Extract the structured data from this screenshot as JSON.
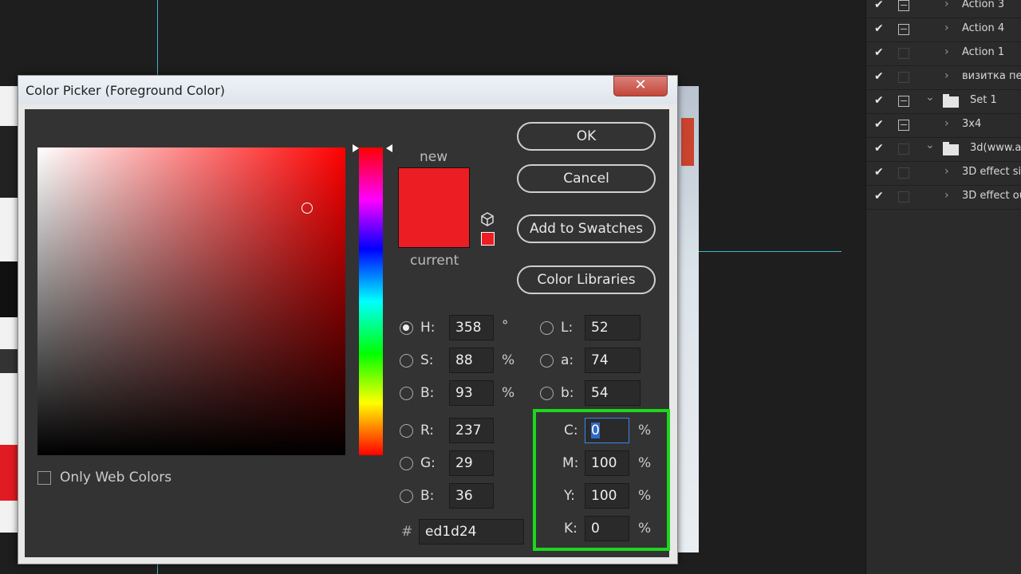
{
  "dialog": {
    "title": "Color Picker (Foreground Color)",
    "close_glyph": "✕",
    "new_label": "new",
    "current_label": "current",
    "new_color": "#ed1d24",
    "current_color": "#ed1d24",
    "buttons": {
      "ok": "OK",
      "cancel": "Cancel",
      "add_swatches": "Add to Swatches",
      "color_libraries": "Color Libraries"
    },
    "only_web_colors": "Only Web Colors",
    "hsb": {
      "h_label": "H:",
      "h_value": "358",
      "h_unit": "°",
      "s_label": "S:",
      "s_value": "88",
      "s_unit": "%",
      "b_label": "B:",
      "b_value": "93",
      "b_unit": "%"
    },
    "rgb": {
      "r_label": "R:",
      "r_value": "237",
      "g_label": "G:",
      "g_value": "29",
      "b_label": "B:",
      "b_value": "36"
    },
    "lab": {
      "l_label": "L:",
      "l_value": "52",
      "a_label": "a:",
      "a_value": "74",
      "b_label": "b:",
      "b_value": "54"
    },
    "cmyk": {
      "c_label": "C:",
      "c_value": "0",
      "c_unit": "%",
      "m_label": "M:",
      "m_value": "100",
      "m_unit": "%",
      "y_label": "Y:",
      "y_value": "100",
      "y_unit": "%",
      "k_label": "K:",
      "k_value": "0",
      "k_unit": "%"
    },
    "hex_label": "#",
    "hex_value": "ed1d24"
  },
  "actions_panel": {
    "items": [
      {
        "label": "Action 3"
      },
      {
        "label": "Action 4"
      },
      {
        "label": "Action 1"
      },
      {
        "label": "визитка пе"
      },
      {
        "label": "Set 1"
      },
      {
        "label": "3x4"
      },
      {
        "label": "3d(www.a"
      },
      {
        "label": "3D effect si"
      },
      {
        "label": "3D effect ou"
      }
    ],
    "check_glyph": "✔",
    "expand_glyph": "›",
    "collapse_glyph": "⌄"
  },
  "highlight_color": "#1ed61e"
}
